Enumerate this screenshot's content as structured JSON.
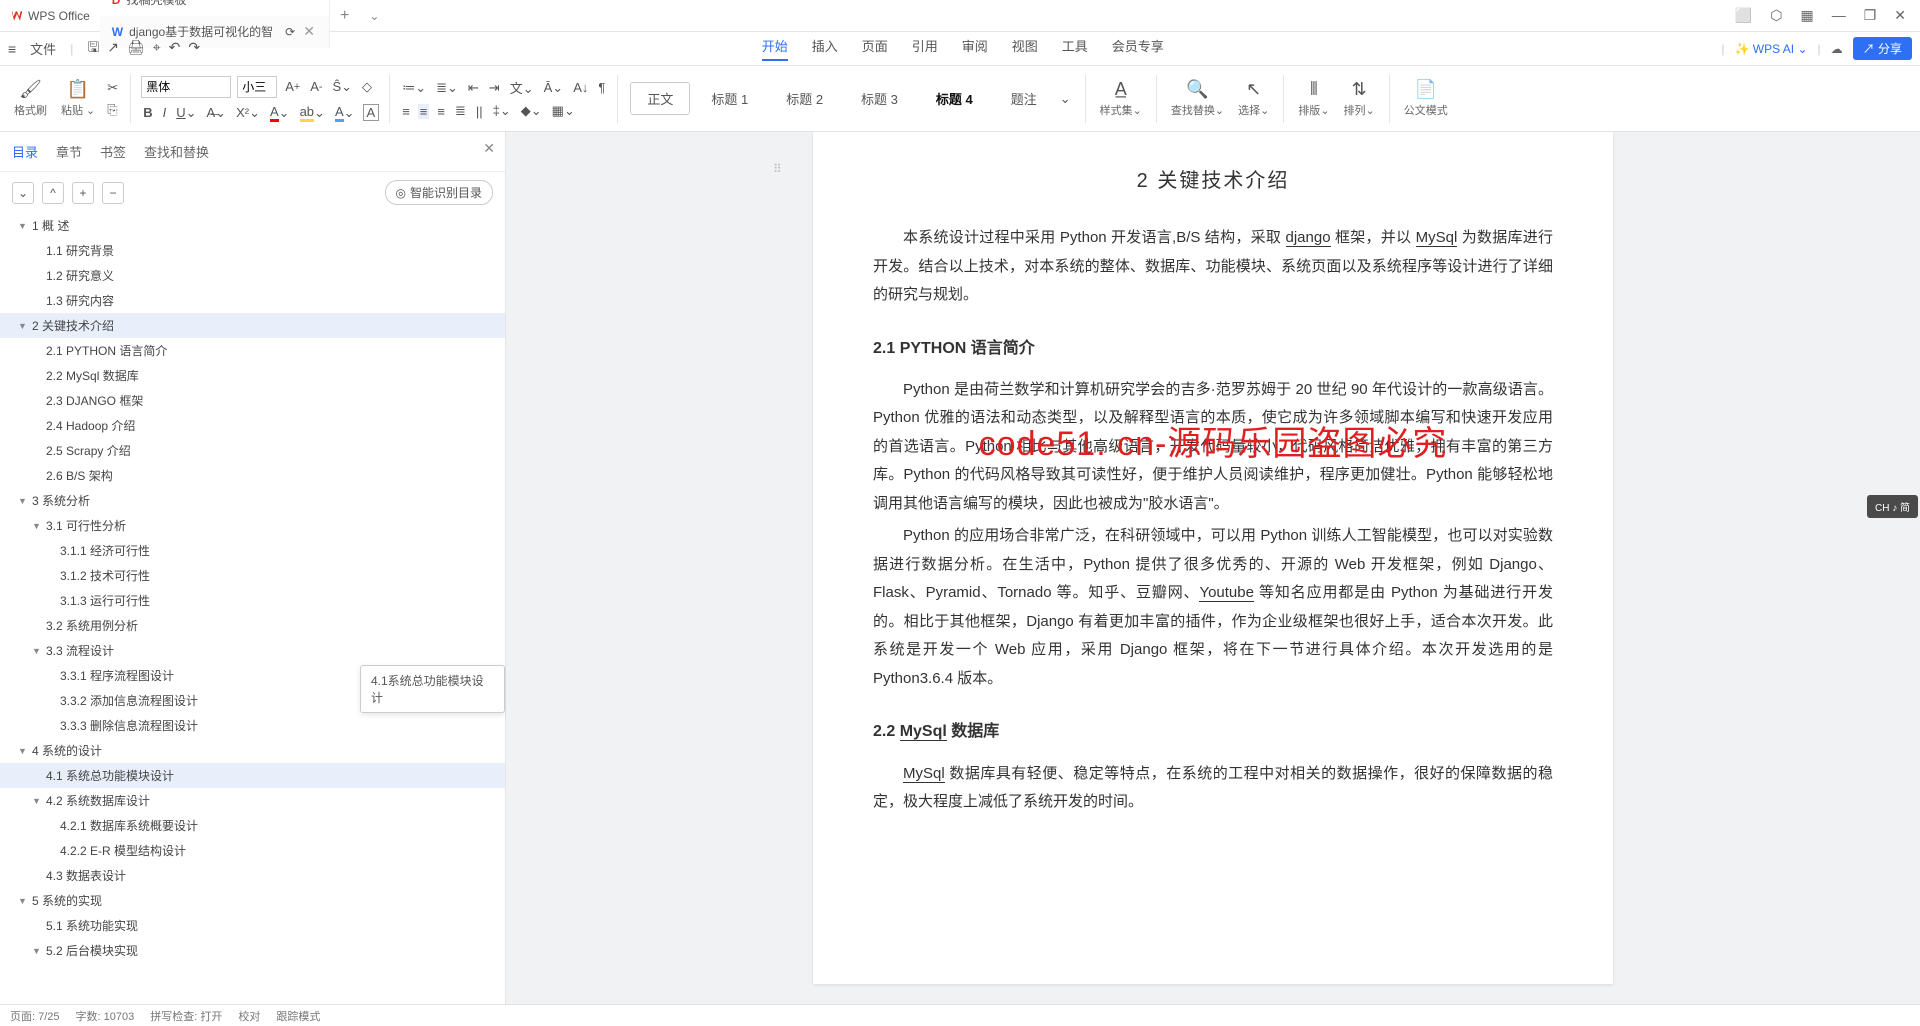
{
  "app": {
    "name": "WPS Office"
  },
  "tabs": [
    {
      "icon": "D",
      "label": "找稿壳模板",
      "color": "#e33"
    },
    {
      "icon": "W",
      "label": "django基于数据可视化的智",
      "color": "#2e6ff3",
      "active": true
    }
  ],
  "titlebar_icons": [
    "⬜",
    "⬡",
    "▦",
    "—",
    "❐",
    "✕"
  ],
  "menubar": {
    "left_icons": [
      "≡"
    ],
    "file": "文件",
    "quick": [
      "🖫",
      "↗",
      "🖨",
      "⌖",
      "↶",
      "↷"
    ],
    "items": [
      "开始",
      "插入",
      "页面",
      "引用",
      "审阅",
      "视图",
      "工具",
      "会员专享"
    ],
    "active": "开始",
    "ai": "WPS AI",
    "cloud": "☁",
    "share": "分享"
  },
  "ribbon": {
    "format_painter": "格式刷",
    "paste": "粘贴",
    "font": "黑体",
    "size": "小三",
    "body": "正文",
    "h1": "标题 1",
    "h2": "标题 2",
    "h3": "标题 3",
    "h4": "标题 4",
    "memo": "题注",
    "style_set": "样式集",
    "find_replace": "查找替换",
    "select": "选择",
    "indent": "排版",
    "sort": "排列",
    "official": "公文模式"
  },
  "toc": {
    "tabs": [
      "目录",
      "章节",
      "书签",
      "查找和替换"
    ],
    "active": "目录",
    "smart": "智能识别目录",
    "items": [
      {
        "lvl": 0,
        "arr": true,
        "txt": "1  概    述"
      },
      {
        "lvl": 1,
        "txt": "1.1 研究背景"
      },
      {
        "lvl": 1,
        "txt": "1.2 研究意义"
      },
      {
        "lvl": 1,
        "txt": "1.3 研究内容"
      },
      {
        "lvl": 0,
        "arr": true,
        "txt": "2  关键技术介绍",
        "sel": true
      },
      {
        "lvl": 1,
        "txt": "2.1 PYTHON 语言简介"
      },
      {
        "lvl": 1,
        "txt": "2.2 MySql 数据库"
      },
      {
        "lvl": 1,
        "txt": "2.3 DJANGO 框架"
      },
      {
        "lvl": 1,
        "txt": "2.4 Hadoop 介绍"
      },
      {
        "lvl": 1,
        "txt": "2.5 Scrapy 介绍"
      },
      {
        "lvl": 1,
        "txt": "2.6 B/S 架构"
      },
      {
        "lvl": 0,
        "arr": true,
        "txt": "3  系统分析"
      },
      {
        "lvl": 1,
        "arr": true,
        "txt": "3.1 可行性分析"
      },
      {
        "lvl": 2,
        "txt": "3.1.1 经济可行性"
      },
      {
        "lvl": 2,
        "txt": "3.1.2 技术可行性"
      },
      {
        "lvl": 2,
        "txt": "3.1.3 运行可行性"
      },
      {
        "lvl": 1,
        "txt": "3.2 系统用例分析"
      },
      {
        "lvl": 1,
        "arr": true,
        "txt": "3.3 流程设计"
      },
      {
        "lvl": 2,
        "txt": "3.3.1 程序流程图设计"
      },
      {
        "lvl": 2,
        "txt": "3.3.2 添加信息流程图设计"
      },
      {
        "lvl": 2,
        "txt": "3.3.3 删除信息流程图设计"
      },
      {
        "lvl": 0,
        "arr": true,
        "txt": "4  系统的设计"
      },
      {
        "lvl": 1,
        "txt": "4.1 系统总功能模块设计",
        "sel": true
      },
      {
        "lvl": 1,
        "arr": true,
        "txt": "4.2 系统数据库设计"
      },
      {
        "lvl": 2,
        "txt": "4.2.1 数据库系统概要设计"
      },
      {
        "lvl": 2,
        "txt": "4.2.2 E-R 模型结构设计"
      },
      {
        "lvl": 1,
        "txt": "4.3 数据表设计"
      },
      {
        "lvl": 0,
        "arr": true,
        "txt": "5  系统的实现"
      },
      {
        "lvl": 1,
        "txt": "5.1 系统功能实现"
      },
      {
        "lvl": 1,
        "arr": true,
        "txt": "5.2 后台模块实现"
      }
    ],
    "tooltip": "4.1系统总功能模块设计"
  },
  "doc": {
    "h2": "2  关键技术介绍",
    "p1a": "本系统设计过程中采用 Python 开发语言,B/S 结构，采取 ",
    "p1b": "django",
    "p1c": " 框架，并以 ",
    "p1d": "MySql",
    "p1e": " 为数据库进行开发。结合以上技术，对本系统的整体、数据库、功能模块、系统页面以及系统程序等设计进行了详细的研究与规划。",
    "h3a": "2.1 PYTHON 语言简介",
    "p2": "Python 是由荷兰数学和计算机研究学会的吉多·范罗苏姆于 20 世纪 90 年代设计的一款高级语言。Python 优雅的语法和动态类型，以及解释型语言的本质，使它成为许多领域脚本编写和快速开发应用的首选语言。Python 相比与其他高级语言，开发代码量较小，代码风格简洁优雅，拥有丰富的第三方库。Python 的代码风格导致其可读性好，便于维护人员阅读维护，程序更加健壮。Python 能够轻松地调用其他语言编写的模块，因此也被成为\"胶水语言\"。",
    "p3a": "Python 的应用场合非常广泛，在科研领域中，可以用 Python 训练人工智能模型，也可以对实验数据进行数据分析。在生活中，Python 提供了很多优秀的、开源的 Web 开发框架，例如 Django、Flask、Pyramid、Tornado 等。知乎、豆瓣网、",
    "p3b": "Youtube",
    "p3c": " 等知名应用都是由 Python 为基础进行开发的。相比于其他框架，Django 有着更加丰富的插件，作为企业级框架也很好上手，适合本次开发。此系统是开发一个 Web 应用，采用 Django 框架，将在下一节进行具体介绍。本次开发选用的是 Python3.6.4 版本。",
    "h3b": "2.2 MySql 数据库",
    "p4a": "MySql",
    "p4b": " 数据库具有轻便、稳定等特点，在系统的工程中对相关的数据操作，很好的保障数据的稳定，极大程度上减低了系统开发的时间。"
  },
  "watermark": "code51. cn-源码乐园盗图必究",
  "ime": "CH ♪ 简",
  "status": {
    "page": "页面: 7/25",
    "words": "字数: 10703",
    "spell": "拼写检查: 打开",
    "proof": "校对",
    "read": "跟踪模式"
  }
}
